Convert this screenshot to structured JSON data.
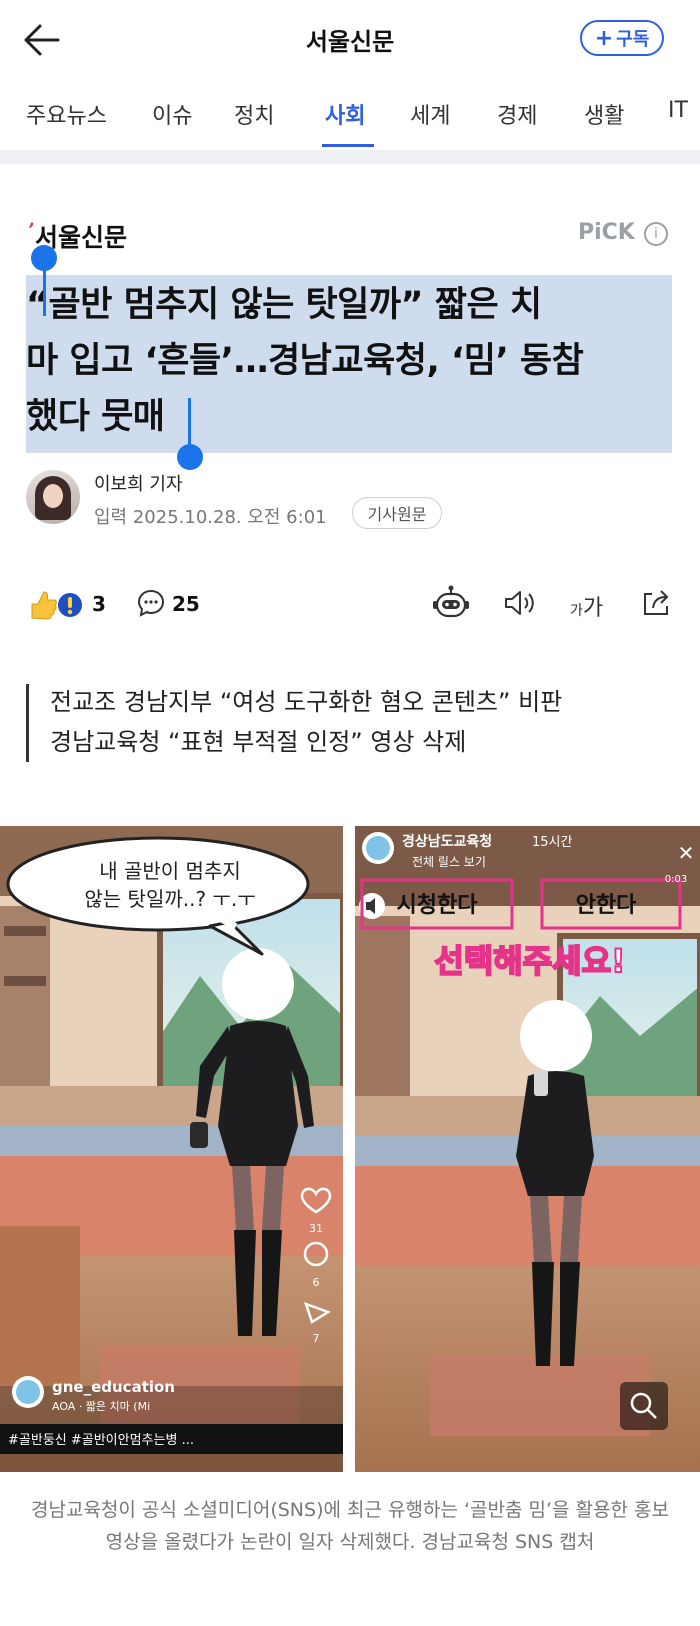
{
  "header": {
    "title": "서울신문",
    "subscribe_label": "구독"
  },
  "tabs": [
    {
      "label": "주요뉴스"
    },
    {
      "label": "이슈"
    },
    {
      "label": "정치"
    },
    {
      "label": "사회",
      "active": true
    },
    {
      "label": "세계"
    },
    {
      "label": "경제"
    },
    {
      "label": "생활"
    },
    {
      "label": "IT"
    }
  ],
  "article": {
    "press_name": "서울신문",
    "pick_label": "PiCK",
    "pick_info_glyph": "i",
    "headline_lines": [
      "“골반 멈추지 않는 탓일까” 짧은 치",
      "마 입고 ‘흔들’…경남교육청, ‘밈’ 동참",
      "했다 뭇매"
    ],
    "author": "이보희 기자",
    "date": "입력 2025.10.28. 오전 6:01",
    "original_link_label": "기사원문",
    "reaction_count": "3",
    "comment_count": "25",
    "font_size_label_small": "가",
    "font_size_label_large": "가",
    "summary_lines": [
      "전교조 경남지부 “여성 도구화한 혐오 콘텐츠” 비판",
      "경남교육청 “표현 부적절 인정” 영상 삭제"
    ],
    "photo": {
      "left": {
        "speech_bubble_lines": [
          "내 골반이 멈추지",
          "않는 탓일까..? ㅜ.ㅜ"
        ],
        "like_count": "31",
        "comment_count": "6",
        "share_count": "7",
        "account": "gne_education",
        "music": "AOA · 짧은 치마 (Mi",
        "hashtags": "#골반둥신 #골반이안멈추는병 ..."
      },
      "right": {
        "account": "경상남도교육청",
        "time": "15시간",
        "reels_label": "전체 릴스 보기",
        "option_a": "시청한다",
        "option_b": "안한다",
        "timer": "0:03",
        "choose_text": "선택해주세요!",
        "close_glyph": "✕"
      }
    },
    "caption": "경남교육청이 공식 소셜미디어(SNS)에 최근 유행하는 ‘골반춤 밈’을 활용한 홍보 영상을 올렸다가 논란이 일자 삭제했다. 경남교육청 SNS 캡처"
  },
  "colors": {
    "accent": "#2d5fe0",
    "selection": "#cfdcee",
    "handle": "#1a73e8",
    "divider": "#eef0f4",
    "neon_pink": "#e6338a"
  },
  "icons": [
    "back-arrow-icon",
    "plus-icon",
    "info-icon",
    "reaction-icon",
    "comment-icon",
    "summary-bot-icon",
    "speaker-icon",
    "font-size-icon",
    "share-icon",
    "zoom-icon",
    "heart-icon",
    "send-icon",
    "close-icon",
    "mute-icon"
  ]
}
